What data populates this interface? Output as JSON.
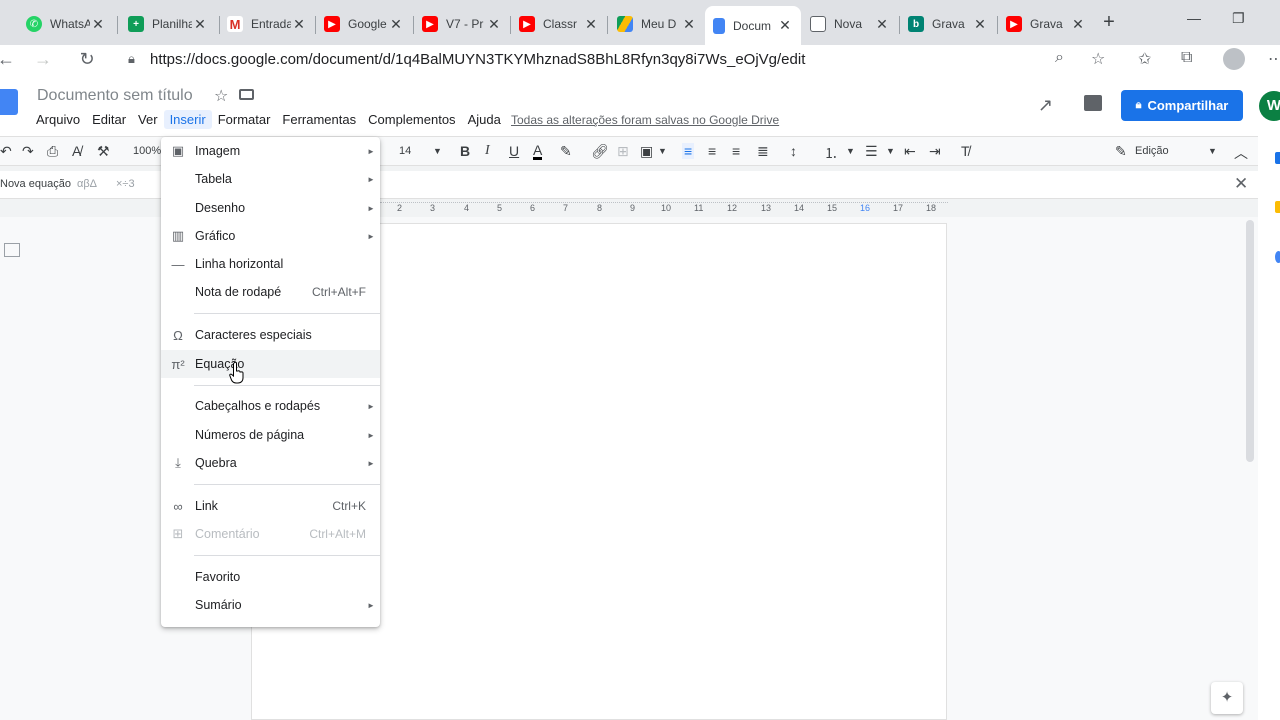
{
  "browser": {
    "tabs": [
      {
        "title": "WhatsApp",
        "icon": "whatsapp-icon",
        "color": "#25d366"
      },
      {
        "title": "Planilha",
        "icon": "sheets-icon",
        "color": "#0f9d58"
      },
      {
        "title": "Entrada",
        "icon": "gmail-icon",
        "color": "#d93025"
      },
      {
        "title": "Google",
        "icon": "youtube-icon",
        "color": "#ff0000"
      },
      {
        "title": "V7 - Pr",
        "icon": "youtube-icon",
        "color": "#ff0000"
      },
      {
        "title": "Classr",
        "icon": "youtube-icon",
        "color": "#ff0000"
      },
      {
        "title": "Meu D",
        "icon": "drive-icon",
        "color": "#fbbc04"
      },
      {
        "title": "Docum",
        "icon": "docs-icon",
        "color": "#4285f4"
      },
      {
        "title": "Nova",
        "icon": "newtab-icon",
        "color": "#5f6368"
      },
      {
        "title": "Grava",
        "icon": "bing-icon",
        "color": "#008373"
      },
      {
        "title": "Grava",
        "icon": "youtube-icon",
        "color": "#ff0000"
      }
    ],
    "url": "https://docs.google.com/document/d/1q4BalMUYN3TKYMhznadS8BhL8Rfyn3qy8i7Ws_eOjVg/edit"
  },
  "doc": {
    "title": "Documento sem título",
    "menus": [
      "Arquivo",
      "Editar",
      "Ver",
      "Inserir",
      "Formatar",
      "Ferramentas",
      "Complementos",
      "Ajuda"
    ],
    "saved_status": "Todas as alterações foram salvas no Google Drive",
    "share_label": "Compartilhar",
    "avatar_letter": "W"
  },
  "toolbar": {
    "zoom": "100%",
    "font_size": "14",
    "mode": "Edição"
  },
  "equation_bar": {
    "label": "Nova equação",
    "greek": "αβΔ",
    "ops": "×÷3"
  },
  "ruler": [
    "2",
    "3",
    "4",
    "5",
    "6",
    "7",
    "8",
    "9",
    "10",
    "11",
    "12",
    "13",
    "14",
    "15",
    "16",
    "17",
    "18"
  ],
  "insert_menu": {
    "items": [
      {
        "label": "Imagem",
        "icon": "image-icon",
        "submenu": true
      },
      {
        "label": "Tabela",
        "icon": "",
        "submenu": true
      },
      {
        "label": "Desenho",
        "icon": "",
        "submenu": true
      },
      {
        "label": "Gráfico",
        "icon": "chart-icon",
        "submenu": true
      },
      {
        "label": "Linha horizontal",
        "icon": "horizontal-line-icon",
        "submenu": false
      },
      {
        "label": "Nota de rodapé",
        "shortcut": "Ctrl+Alt+F"
      },
      {
        "label": "Caracteres especiais",
        "icon": "omega-icon"
      },
      {
        "label": "Equação",
        "icon": "pi-icon",
        "highlighted": true
      },
      {
        "label": "Cabeçalhos e rodapés",
        "submenu": true
      },
      {
        "label": "Números de página",
        "submenu": true
      },
      {
        "label": "Quebra",
        "icon": "page-break-icon",
        "submenu": true
      },
      {
        "label": "Link",
        "icon": "link-icon",
        "shortcut": "Ctrl+K"
      },
      {
        "label": "Comentário",
        "icon": "add-comment-icon",
        "shortcut": "Ctrl+Alt+M",
        "disabled": true
      },
      {
        "label": "Favorito"
      },
      {
        "label": "Sumário",
        "submenu": true
      }
    ]
  }
}
